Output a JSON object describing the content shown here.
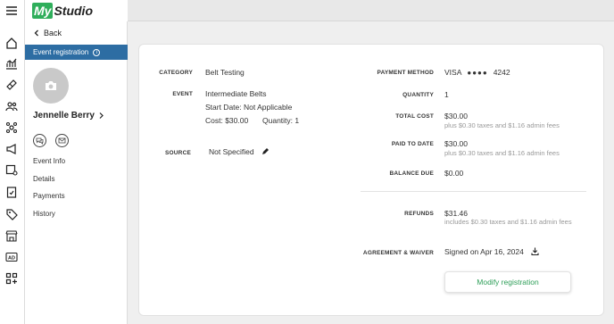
{
  "header": {
    "logo_prefix": "My",
    "logo_suffix": "Studio"
  },
  "rail": {
    "icons": [
      "menu-icon",
      "home-icon",
      "analytics-icon",
      "ticket-icon",
      "people-icon",
      "molecule-icon",
      "megaphone-icon",
      "calendar-settings-icon",
      "clipboard-icon",
      "tag-icon",
      "store-icon",
      "ad-icon",
      "apps-icon"
    ],
    "ad_label": "AD"
  },
  "sidebar": {
    "back_label": "Back",
    "active_label": "Event registration",
    "info_glyph": "i",
    "contact_name": "Jennelle Berry",
    "nav": [
      "Event Info",
      "Details",
      "Payments",
      "History"
    ]
  },
  "registration": {
    "category_label": "CATEGORY",
    "category_value": "Belt Testing",
    "event_label": "EVENT",
    "event_name": "Intermediate Belts",
    "start_date": "Start Date:  Not Applicable",
    "cost": "Cost: $30.00",
    "quantity_inline": "Quantity: 1",
    "source_label": "SOURCE",
    "source_value": "Not Specified"
  },
  "payment": {
    "method_label": "PAYMENT METHOD",
    "card_brand": "VISA",
    "card_mask": "●●●●",
    "card_last4": "4242",
    "quantity_label": "QUANTITY",
    "quantity_value": "1",
    "total_label": "TOTAL COST",
    "total_value": "$30.00",
    "total_note": "plus $0.30 taxes and $1.16 admin fees",
    "paid_label": "PAID TO DATE",
    "paid_value": "$30.00",
    "paid_note": "plus $0.30 taxes and $1.16 admin fees",
    "balance_label": "BALANCE DUE",
    "balance_value": "$0.00",
    "refunds_label": "REFUNDS",
    "refunds_value": "$31.46",
    "refunds_note": "includes $0.30 taxes and $1.16 admin fees",
    "agreement_label": "AGREEMENT & WAIVER",
    "agreement_value": "Signed on Apr 16, 2024",
    "modify_button": "Modify registration"
  },
  "colors": {
    "brand_green": "#2fae5b",
    "active_blue": "#2d6da3",
    "button_text": "#2e9e58"
  }
}
